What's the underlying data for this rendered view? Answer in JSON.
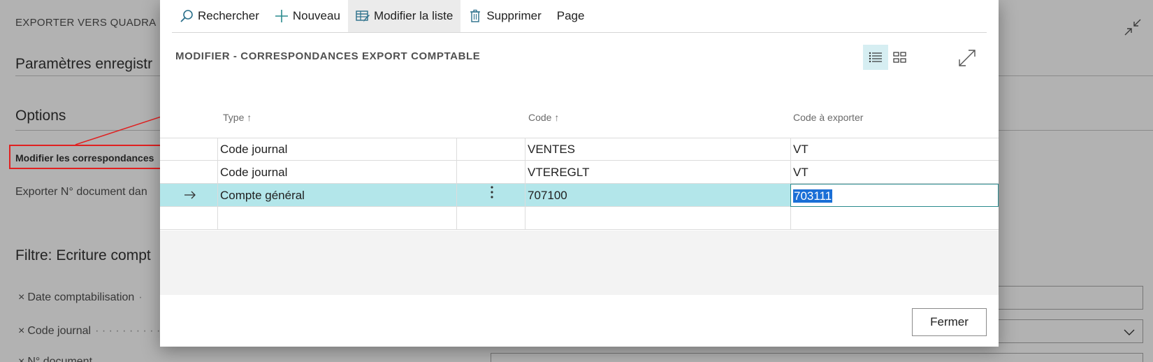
{
  "background": {
    "page_title": "EXPORTER VERS QUADRA",
    "section_params": "Paramètres enregistr",
    "section_options": "Options",
    "modifier_link": "Modifier les correspondances",
    "export_label": "Exporter N° document dan",
    "section_filtre": "Filtre: Ecriture compt",
    "filters": [
      {
        "label": "Date comptabilisation"
      },
      {
        "label": "Code journal"
      },
      {
        "label": "N° document"
      }
    ]
  },
  "actionbar": {
    "search": "Rechercher",
    "new": "Nouveau",
    "edit_list": "Modifier la liste",
    "delete": "Supprimer",
    "page": "Page"
  },
  "dialog": {
    "title": "MODIFIER - CORRESPONDANCES EXPORT COMPTABLE",
    "close": "Fermer"
  },
  "table": {
    "columns": {
      "type": "Type",
      "code": "Code",
      "export_code": "Code à exporter"
    },
    "rows": [
      {
        "type": "Code journal",
        "code": "VENTES",
        "export_code": "VT"
      },
      {
        "type": "Code journal",
        "code": "VTEREGLT",
        "export_code": "VT"
      },
      {
        "type": "Compte général",
        "code": "707100",
        "export_code": "703111"
      }
    ]
  },
  "colors": {
    "selected_row": "#b3e6ea",
    "accent": "#2a8a8e",
    "highlight": "#e02020"
  }
}
